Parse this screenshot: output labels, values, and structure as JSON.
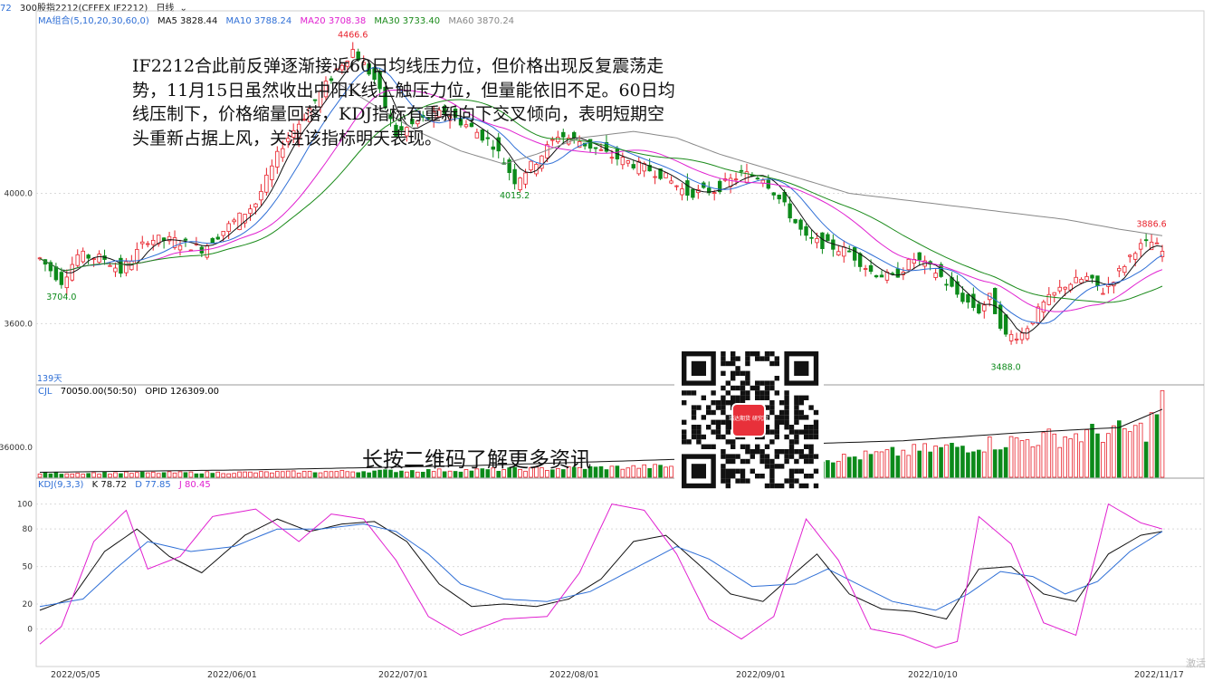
{
  "header": {
    "code": "72",
    "instrument": "300股指2212(CFFEX IF2212)",
    "period": "日线",
    "period_arrow": "⌄"
  },
  "ma_legend": {
    "label": "MA组合(5,10,20,30,60,0)",
    "items": [
      {
        "text": "MA5 3828.44",
        "color": "#111111"
      },
      {
        "text": "MA10 3788.24",
        "color": "#2f6fd6"
      },
      {
        "text": "MA20 3708.38",
        "color": "#e020d0"
      },
      {
        "text": "MA30 3733.40",
        "color": "#1a8a1a"
      },
      {
        "text": "MA60 3870.24",
        "color": "#888888"
      }
    ]
  },
  "vol_legend": {
    "label": "CJL",
    "items": [
      {
        "text": "70050.00(50:50)",
        "color": "#111111"
      },
      {
        "text": "OPID 126309.00",
        "color": "#111111"
      }
    ]
  },
  "kdj_legend": {
    "label": "KDJ(9,3,3)",
    "items": [
      {
        "text": "K 78.72",
        "color": "#111111"
      },
      {
        "text": "D 77.85",
        "color": "#2f6fd6"
      },
      {
        "text": "J 80.45",
        "color": "#e020d0"
      }
    ]
  },
  "commentary": "IF2212合此前反弹逐渐接近60日均线压力位，但价格出现反复震荡走势，11月15日虽然收出中阳K线上触压力位，但量能依旧不足。60日均线压制下，价格缩量回落，KDJ指标有重新向下交叉倾向，表明短期空头重新占据上风，关注该指标明天表现。",
  "qr": {
    "center_text": "瑞达期货 研究院",
    "caption": "长按二维码了解更多资讯"
  },
  "watermark": "激活",
  "colors": {
    "up": "#e8202a",
    "down": "#0c8a1a",
    "grid": "#d9d9d9",
    "axis": "#999999"
  },
  "chart_data": {
    "type": "candlestick",
    "x_tick_labels": [
      "2022/05/05",
      "2022/06/01",
      "2022/07/01",
      "2022/08/01",
      "2022/09/01",
      "2022/10/10",
      "2022/11/17"
    ],
    "price_axis": {
      "ticks": [
        4000.0,
        3600.0
      ],
      "ylim": [
        3440,
        4560
      ]
    },
    "annotations": [
      {
        "text": "4466.6",
        "value": 4466.6,
        "color": "#e8202a"
      },
      {
        "text": "4015.2",
        "value": 4015.2,
        "color": "#0c8a1a"
      },
      {
        "text": "3704.0",
        "value": 3704.0,
        "color": "#0c8a1a"
      },
      {
        "text": "3488.0",
        "value": 3488.0,
        "color": "#0c8a1a"
      },
      {
        "text": "3886.6",
        "value": 3886.6,
        "color": "#e8202a"
      }
    ],
    "days_label": "139天",
    "close_anchors": [
      [
        0,
        3800
      ],
      [
        4,
        3730
      ],
      [
        7,
        3810
      ],
      [
        12,
        3800
      ],
      [
        15,
        3760
      ],
      [
        20,
        3860
      ],
      [
        25,
        3855
      ],
      [
        30,
        3830
      ],
      [
        35,
        3900
      ],
      [
        40,
        3970
      ],
      [
        45,
        4150
      ],
      [
        50,
        4260
      ],
      [
        55,
        4380
      ],
      [
        58,
        4440
      ],
      [
        62,
        4350
      ],
      [
        66,
        4180
      ],
      [
        70,
        4220
      ],
      [
        75,
        4250
      ],
      [
        80,
        4200
      ],
      [
        84,
        4150
      ],
      [
        88,
        4040
      ],
      [
        92,
        4100
      ],
      [
        96,
        4180
      ],
      [
        100,
        4160
      ],
      [
        105,
        4120
      ],
      [
        110,
        4090
      ],
      [
        115,
        4060
      ],
      [
        120,
        4000
      ],
      [
        125,
        4010
      ],
      [
        130,
        4060
      ],
      [
        134,
        4050
      ],
      [
        138,
        3960
      ],
      [
        142,
        3860
      ],
      [
        146,
        3840
      ],
      [
        150,
        3820
      ],
      [
        154,
        3760
      ],
      [
        158,
        3740
      ],
      [
        162,
        3800
      ],
      [
        166,
        3760
      ],
      [
        170,
        3690
      ],
      [
        174,
        3640
      ],
      [
        176,
        3680
      ],
      [
        179,
        3560
      ],
      [
        182,
        3570
      ],
      [
        186,
        3660
      ],
      [
        190,
        3720
      ],
      [
        194,
        3740
      ],
      [
        197,
        3700
      ],
      [
        200,
        3760
      ],
      [
        203,
        3830
      ],
      [
        206,
        3850
      ],
      [
        208,
        3820
      ]
    ],
    "ma60_anchors": [
      [
        55,
        4340
      ],
      [
        62,
        4270
      ],
      [
        70,
        4190
      ],
      [
        78,
        4130
      ],
      [
        86,
        4090
      ],
      [
        92,
        4120
      ],
      [
        100,
        4170
      ],
      [
        110,
        4190
      ],
      [
        118,
        4170
      ],
      [
        126,
        4120
      ],
      [
        134,
        4080
      ],
      [
        142,
        4040
      ],
      [
        150,
        4000
      ],
      [
        160,
        3980
      ],
      [
        170,
        3960
      ],
      [
        180,
        3940
      ],
      [
        190,
        3920
      ],
      [
        200,
        3890
      ],
      [
        208,
        3870
      ]
    ],
    "volume_axis": {
      "ticks": [
        36000.0
      ],
      "ylim": [
        0,
        95000
      ]
    },
    "volume_anchors": [
      [
        0,
        5000
      ],
      [
        40,
        6000
      ],
      [
        80,
        9000
      ],
      [
        120,
        14000
      ],
      [
        150,
        25000
      ],
      [
        175,
        42000
      ],
      [
        195,
        55000
      ],
      [
        205,
        60000
      ],
      [
        208,
        95000
      ]
    ],
    "opid_anchors": [
      [
        0,
        6000
      ],
      [
        40,
        9000
      ],
      [
        80,
        14000
      ],
      [
        120,
        22000
      ],
      [
        140,
        40000
      ],
      [
        160,
        44000
      ],
      [
        180,
        53000
      ],
      [
        200,
        60000
      ],
      [
        208,
        82000
      ]
    ],
    "kdj_axis": {
      "ticks": [
        100,
        80,
        50,
        20,
        0
      ],
      "ylim": [
        -30,
        112
      ]
    },
    "k_anchors": [
      [
        0,
        15
      ],
      [
        6,
        25
      ],
      [
        12,
        62
      ],
      [
        18,
        80
      ],
      [
        24,
        58
      ],
      [
        30,
        45
      ],
      [
        38,
        75
      ],
      [
        44,
        88
      ],
      [
        50,
        78
      ],
      [
        56,
        84
      ],
      [
        62,
        86
      ],
      [
        68,
        70
      ],
      [
        74,
        36
      ],
      [
        80,
        18
      ],
      [
        86,
        20
      ],
      [
        92,
        18
      ],
      [
        98,
        24
      ],
      [
        104,
        40
      ],
      [
        110,
        70
      ],
      [
        116,
        75
      ],
      [
        122,
        52
      ],
      [
        128,
        28
      ],
      [
        134,
        22
      ],
      [
        140,
        45
      ],
      [
        144,
        60
      ],
      [
        150,
        28
      ],
      [
        156,
        16
      ],
      [
        162,
        14
      ],
      [
        168,
        8
      ],
      [
        174,
        48
      ],
      [
        180,
        50
      ],
      [
        186,
        28
      ],
      [
        192,
        22
      ],
      [
        198,
        60
      ],
      [
        204,
        75
      ],
      [
        208,
        78
      ]
    ],
    "d_anchors": [
      [
        0,
        18
      ],
      [
        8,
        24
      ],
      [
        14,
        48
      ],
      [
        20,
        70
      ],
      [
        28,
        62
      ],
      [
        36,
        66
      ],
      [
        44,
        80
      ],
      [
        52,
        80
      ],
      [
        60,
        84
      ],
      [
        66,
        78
      ],
      [
        72,
        60
      ],
      [
        78,
        36
      ],
      [
        86,
        24
      ],
      [
        94,
        22
      ],
      [
        102,
        30
      ],
      [
        110,
        48
      ],
      [
        118,
        66
      ],
      [
        124,
        56
      ],
      [
        132,
        34
      ],
      [
        140,
        36
      ],
      [
        146,
        48
      ],
      [
        152,
        35
      ],
      [
        158,
        22
      ],
      [
        166,
        15
      ],
      [
        172,
        28
      ],
      [
        178,
        46
      ],
      [
        184,
        42
      ],
      [
        190,
        28
      ],
      [
        196,
        38
      ],
      [
        202,
        62
      ],
      [
        208,
        78
      ]
    ],
    "j_anchors": [
      [
        0,
        -12
      ],
      [
        4,
        2
      ],
      [
        10,
        70
      ],
      [
        16,
        95
      ],
      [
        20,
        48
      ],
      [
        26,
        58
      ],
      [
        32,
        90
      ],
      [
        40,
        96
      ],
      [
        48,
        70
      ],
      [
        54,
        92
      ],
      [
        60,
        88
      ],
      [
        66,
        55
      ],
      [
        72,
        10
      ],
      [
        78,
        -5
      ],
      [
        86,
        8
      ],
      [
        94,
        10
      ],
      [
        100,
        45
      ],
      [
        106,
        100
      ],
      [
        112,
        95
      ],
      [
        118,
        60
      ],
      [
        124,
        8
      ],
      [
        130,
        -8
      ],
      [
        136,
        10
      ],
      [
        142,
        88
      ],
      [
        148,
        55
      ],
      [
        154,
        0
      ],
      [
        160,
        -5
      ],
      [
        166,
        -15
      ],
      [
        170,
        -10
      ],
      [
        174,
        90
      ],
      [
        180,
        68
      ],
      [
        186,
        5
      ],
      [
        192,
        -5
      ],
      [
        198,
        100
      ],
      [
        204,
        85
      ],
      [
        208,
        80
      ]
    ]
  }
}
